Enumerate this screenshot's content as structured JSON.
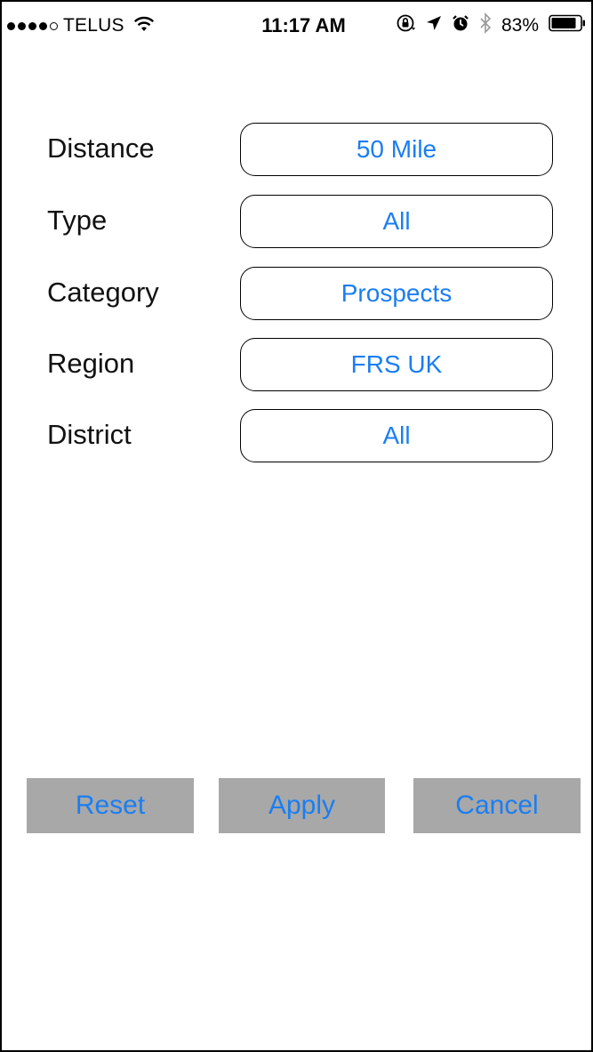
{
  "status_bar": {
    "carrier": "TELUS",
    "time": "11:17 AM",
    "battery_percent": "83%",
    "signal_bars_filled": 4,
    "signal_bars_total": 5,
    "icons": [
      "wifi-icon",
      "orientation-lock-icon",
      "location-arrow-icon",
      "alarm-icon",
      "bluetooth-icon",
      "battery-icon"
    ]
  },
  "filters": [
    {
      "label": "Distance",
      "value": "50 Mile"
    },
    {
      "label": "Type",
      "value": "All"
    },
    {
      "label": "Category",
      "value": "Prospects"
    },
    {
      "label": "Region",
      "value": "FRS UK"
    },
    {
      "label": "District",
      "value": "All"
    }
  ],
  "actions": {
    "reset": "Reset",
    "apply": "Apply",
    "cancel": "Cancel"
  },
  "colors": {
    "accent": "#1a7ef2",
    "button_background": "#a8a8a8",
    "border": "#000000"
  }
}
